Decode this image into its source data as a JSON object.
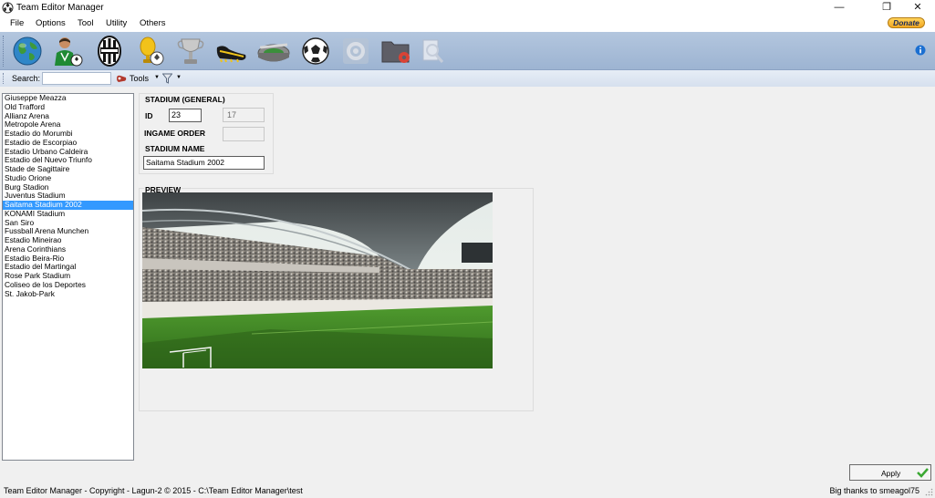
{
  "window": {
    "title": "Team Editor Manager",
    "controls": {
      "minimize": "—",
      "restore": "❐",
      "close": "✕"
    }
  },
  "menu": {
    "items": [
      "File",
      "Options",
      "Tool",
      "Utility",
      "Others"
    ],
    "donate_label": "Donate"
  },
  "toolbar": {
    "buttons": [
      {
        "icon": "globe-icon",
        "enabled": true
      },
      {
        "icon": "players-icon",
        "enabled": true
      },
      {
        "icon": "team-shield-icon",
        "enabled": true
      },
      {
        "icon": "gold-trophy-icon",
        "enabled": true
      },
      {
        "icon": "silver-cup-icon",
        "enabled": true
      },
      {
        "icon": "boot-icon",
        "enabled": true
      },
      {
        "icon": "stadium-icon",
        "enabled": true
      },
      {
        "icon": "ball-icon",
        "enabled": true
      },
      {
        "icon": "gear-icon",
        "enabled": false
      },
      {
        "icon": "folder-settings-icon",
        "enabled": true
      },
      {
        "icon": "search-zoom-icon",
        "enabled": false
      }
    ],
    "info_icon": "info-icon"
  },
  "searchbar": {
    "label": "Search:",
    "value": "",
    "tools_label": "Tools"
  },
  "stadiums": {
    "items": [
      "Giuseppe Meazza",
      "Old Trafford",
      "Allianz Arena",
      "Metropole Arena",
      "Estadio do Morumbi",
      "Estadio de Escorpiao",
      "Estadio Urbano Caldeira",
      "Estadio del Nuevo Triunfo",
      "Stade de Sagittaire",
      "Studio Orione",
      "Burg Stadion",
      "Juventus Stadium",
      "Saitama Stadium 2002",
      "KONAMI Stadium",
      "San Siro",
      "Fussball Arena Munchen",
      "Estadio Mineirao",
      "Arena Corinthians",
      "Estadio Beira-Rio",
      "Estadio del Martingal",
      "Rose Park Stadium",
      "Coliseo de los Deportes",
      "St. Jakob-Park"
    ],
    "selected_index": 12
  },
  "general": {
    "group_title": "STADIUM (GENERAL)",
    "id_label": "ID",
    "id_value": "23",
    "id_secondary": "17",
    "ingame_order_label": "INGAME ORDER",
    "ingame_order_value": "",
    "name_label": "STADIUM NAME",
    "name_value": "Saitama Stadium 2002"
  },
  "preview": {
    "group_title": "PREVIEW"
  },
  "actions": {
    "apply_label": "Apply"
  },
  "status": {
    "left": "Team Editor Manager - Copyright - Lagun-2 © 2015 -  C:\\Team Editor Manager\\test",
    "right": "Big thanks to smeagol75"
  },
  "colors": {
    "toolbar_bg": "#a9bdd8",
    "selection": "#3399ff",
    "donate": "#f2a722"
  }
}
